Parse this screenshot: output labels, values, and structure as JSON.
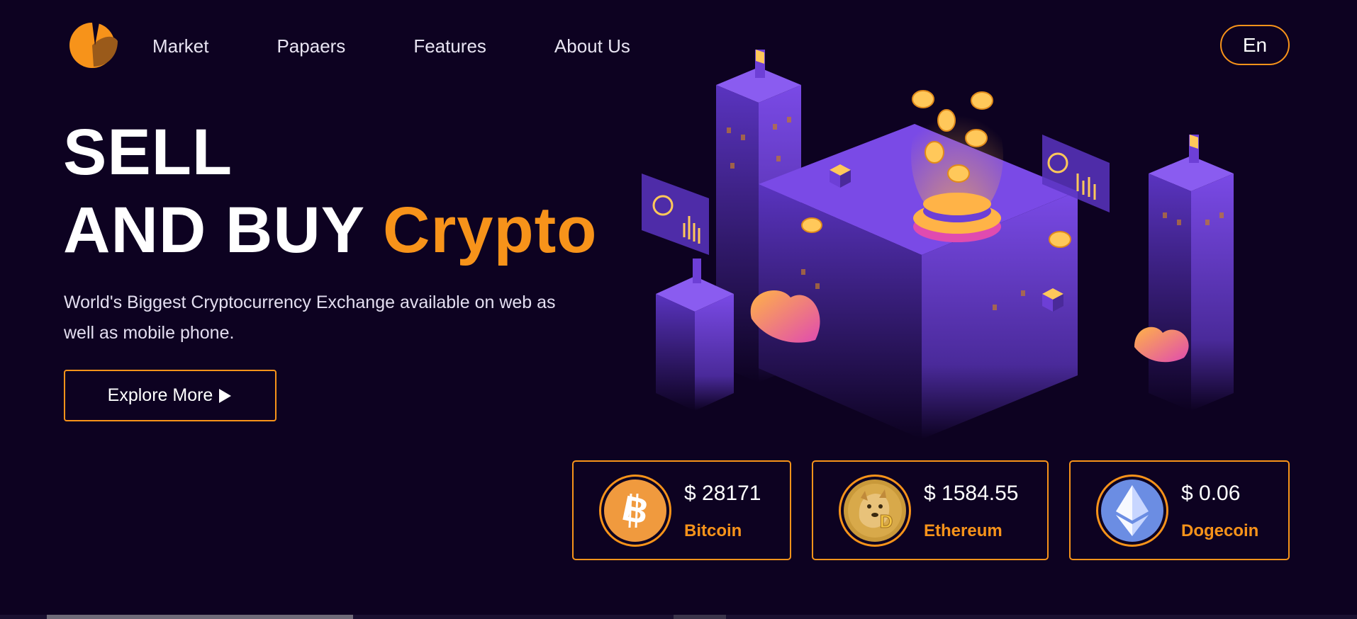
{
  "nav": {
    "items": [
      {
        "label": "Market"
      },
      {
        "label": "Papaers"
      },
      {
        "label": "Features"
      },
      {
        "label": "About Us"
      }
    ],
    "lang_label": "En"
  },
  "hero": {
    "title_line1": "SELL",
    "title_line2": "AND BUY",
    "title_accent": "Crypto",
    "subtitle": "World's Biggest Cryptocurrency Exchange available on web as well as mobile phone.",
    "cta_label": "Explore More",
    "cta_icon": "play-icon"
  },
  "coins": [
    {
      "price": "$ 28171",
      "name": "Bitcoin",
      "icon": "bitcoin-icon"
    },
    {
      "price": "$ 1584.55",
      "name": "Ethereum",
      "icon": "dogecoin-icon"
    },
    {
      "price": "$ 0.06",
      "name": "Dogecoin",
      "icon": "ethereum-icon"
    }
  ],
  "colors": {
    "background": "#0d0221",
    "accent": "#f7931a",
    "purple": "#6d3fd6"
  }
}
